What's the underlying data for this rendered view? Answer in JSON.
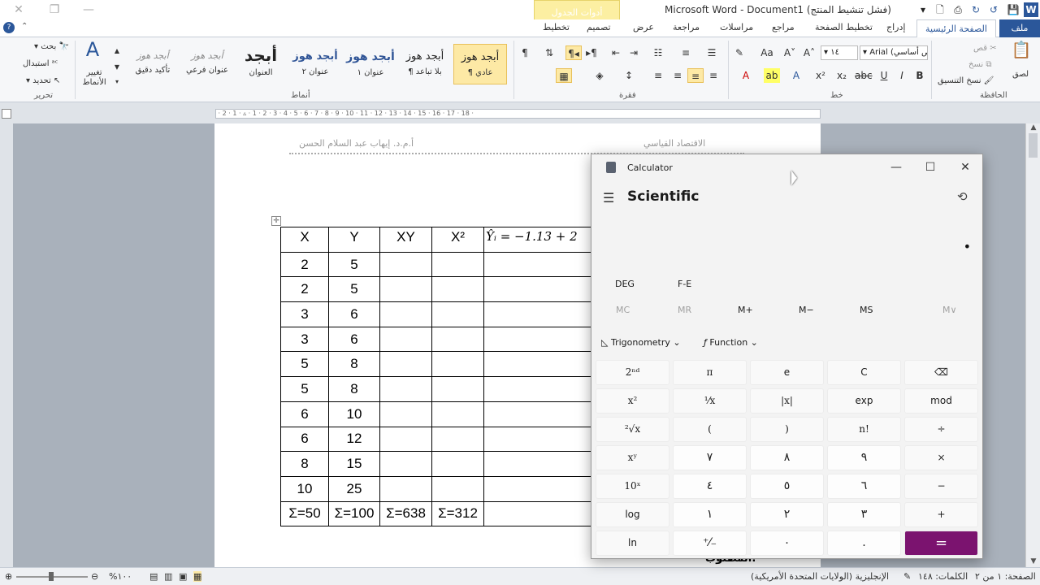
{
  "window": {
    "title": "Microsoft Word - Document1 (فشل تنشيط المنتج)",
    "table_tools": "أدوات الجدول"
  },
  "tabs": {
    "file": "ملف",
    "home": "الصفحة الرئيسية",
    "insert": "إدراج",
    "page_layout": "تخطيط الصفحة",
    "references": "مراجع",
    "mailings": "مراسلات",
    "review": "مراجعة",
    "view": "عرض",
    "design": "تصميم",
    "layout": "تخطيط"
  },
  "ribbon": {
    "clipboard": {
      "label": "الحافظة",
      "paste": "لصق",
      "cut": "قص",
      "copy": "نسخ",
      "format_painter": "نسخ التنسيق"
    },
    "font": {
      "label": "خط",
      "name": "Arial (نص أساسي)",
      "size": "١٤"
    },
    "paragraph": {
      "label": "فقرة"
    },
    "styles": {
      "label": "أنماط",
      "items": [
        {
          "sample": "أبجد هوز",
          "name": "¶ عادي"
        },
        {
          "sample": "أبجد هوز",
          "name": "¶ بلا تباعد"
        },
        {
          "sample": "أبجد هوز",
          "name": "عنوان ١"
        },
        {
          "sample": "أبجد هوز",
          "name": "عنوان ٢"
        },
        {
          "sample": "أبجد",
          "name": "العنوان"
        },
        {
          "sample": "أبجد هوز",
          "name": "عنوان فرعي"
        },
        {
          "sample": "أبجد هوز",
          "name": "تأكيد دقيق"
        }
      ],
      "change_styles": "تغيير الأنماط"
    },
    "editing": {
      "label": "تحرير",
      "find": "بحث",
      "replace": "استبدال",
      "select": "تحديد"
    }
  },
  "document": {
    "header_right": "الاقتصاد القياسي",
    "header_left": "أ.م.د. إيهاب عبد السلام الحسن",
    "table": {
      "headers": [
        "X",
        "Y",
        "XY",
        "X²",
        "Ŷᵢ = −1.13 + 2"
      ],
      "rows": [
        [
          "2",
          "5",
          "",
          "",
          ""
        ],
        [
          "2",
          "5",
          "",
          "",
          ""
        ],
        [
          "3",
          "6",
          "",
          "",
          ""
        ],
        [
          "3",
          "6",
          "",
          "",
          ""
        ],
        [
          "5",
          "8",
          "",
          "",
          ""
        ],
        [
          "5",
          "8",
          "",
          "",
          ""
        ],
        [
          "6",
          "10",
          "",
          "",
          ""
        ],
        [
          "6",
          "12",
          "",
          "",
          ""
        ],
        [
          "8",
          "15",
          "",
          "",
          ""
        ],
        [
          "10",
          "25",
          "",
          "",
          ""
        ]
      ],
      "totals": [
        "Σ=50",
        "Σ=100",
        "Σ=638",
        "Σ=312",
        ""
      ]
    },
    "tail_text": "المطلوب:"
  },
  "statusbar": {
    "page": "الصفحة: ١ من ٢",
    "words": "الكلمات: ١٤٨",
    "language": "الإنجليزية (الولايات المتحدة الأمريكية)",
    "zoom": "%١٠٠"
  },
  "calculator": {
    "title": "Calculator",
    "mode": "Scientific",
    "display": "•",
    "deg": "DEG",
    "fe": "F-E",
    "memory": [
      "MC",
      "MR",
      "M+",
      "M−",
      "MS",
      "M∨"
    ],
    "trigonometry": "Trigonometry",
    "function": "Function",
    "keys": [
      [
        "2ⁿᵈ",
        "π",
        "e",
        "C",
        "⌫"
      ],
      [
        "x²",
        "¹⁄x",
        "|x|",
        "exp",
        "mod"
      ],
      [
        "²√x",
        "(",
        ")",
        "n!",
        "÷"
      ],
      [
        "xʸ",
        "٧",
        "٨",
        "٩",
        "×"
      ],
      [
        "10ˣ",
        "٤",
        "٥",
        "٦",
        "−"
      ],
      [
        "log",
        "١",
        "٢",
        "٣",
        "+"
      ],
      [
        "ln",
        "⁺⁄₋",
        "٠",
        ".",
        "="
      ]
    ]
  }
}
